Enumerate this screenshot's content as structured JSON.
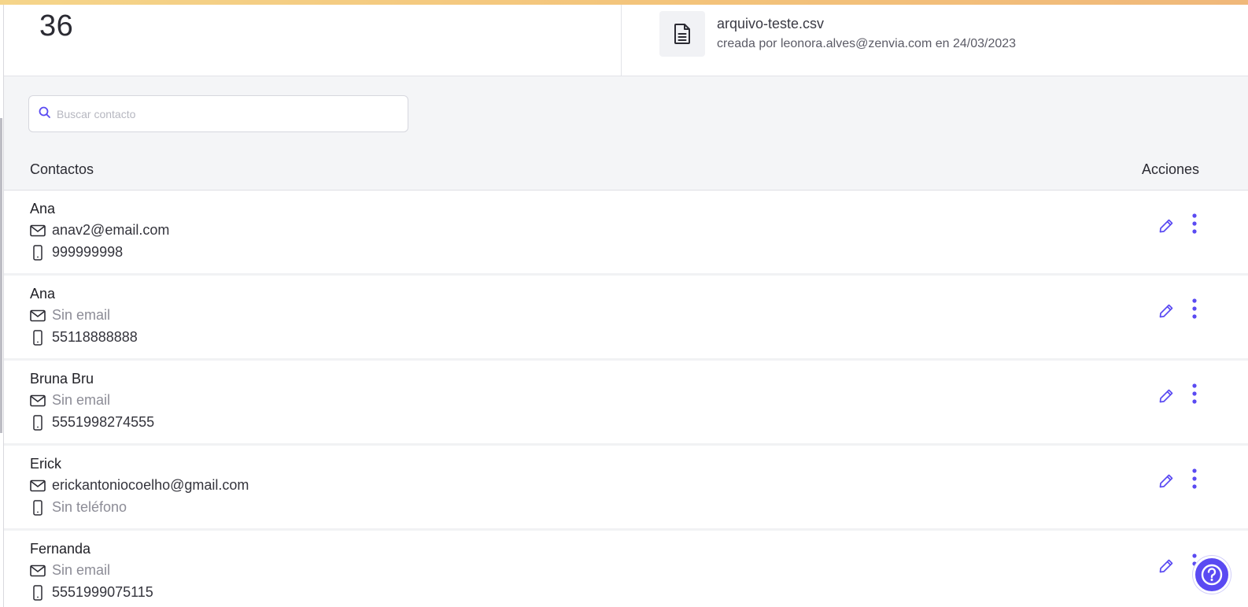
{
  "summary": {
    "count": "36",
    "file": {
      "name": "arquivo-teste.csv",
      "meta": "creada por leonora.alves@zenvia.com en 24/03/2023"
    }
  },
  "search": {
    "placeholder": "Buscar contacto",
    "value": ""
  },
  "table": {
    "headers": {
      "contacts": "Contactos",
      "actions": "Acciones"
    },
    "rows": [
      {
        "name": "Ana",
        "email": "anav2@email.com",
        "phone": "999999998"
      },
      {
        "name": "Ana",
        "email": "Sin email",
        "phone": "55118888888"
      },
      {
        "name": "Bruna Bru",
        "email": "Sin email",
        "phone": "5551998274555"
      },
      {
        "name": "Erick",
        "email": "erickantoniocoelho@gmail.com",
        "phone": "Sin teléfono"
      },
      {
        "name": "Fernanda",
        "email": "Sin email",
        "phone": "5551999075115"
      }
    ]
  },
  "icons": {
    "file": "document-icon",
    "search": "search-icon",
    "email": "envelope-icon",
    "phone": "mobile-phone-icon",
    "edit": "pencil-icon",
    "more": "more-vertical-icon",
    "help": "help-icon"
  },
  "colors": {
    "accent": "#5a4af2",
    "muted_text": "#8c8c96",
    "header_bg": "#f4f5f7",
    "top_bar": "#f3c37a"
  }
}
